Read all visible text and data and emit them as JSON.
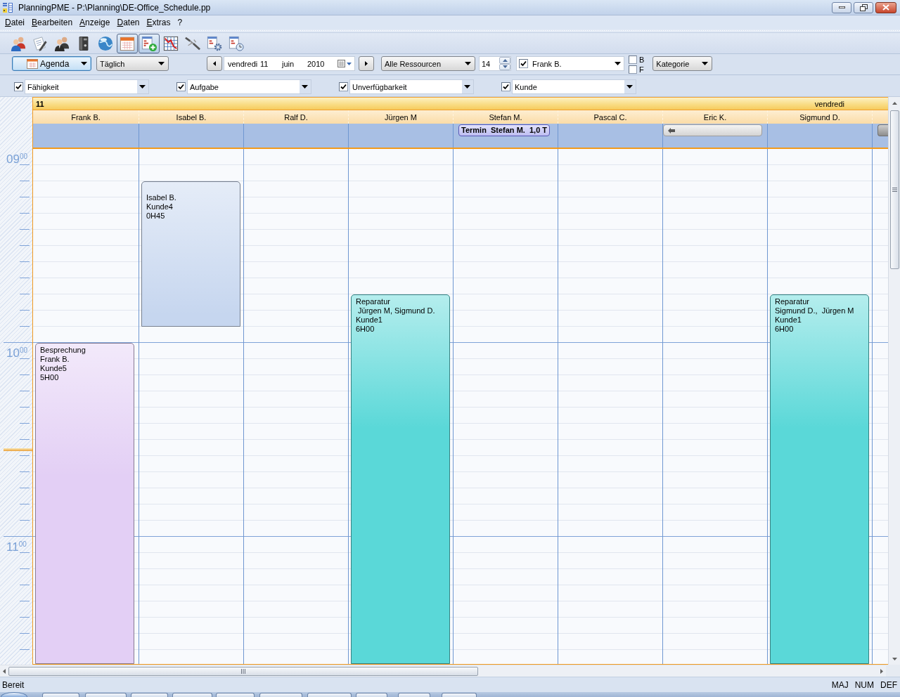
{
  "window": {
    "title": "PlanningPME - P:\\Planning\\DE-Office_Schedule.pp"
  },
  "menu": [
    "Datei",
    "Bearbeiten",
    "Anzeige",
    "Daten",
    "Extras",
    "?"
  ],
  "toolbar": [
    {
      "kind": "people",
      "pressed": false
    },
    {
      "kind": "notes",
      "pressed": false
    },
    {
      "kind": "team",
      "pressed": false
    },
    {
      "kind": "binder",
      "pressed": false
    },
    {
      "kind": "globe",
      "pressed": false
    },
    {
      "kind": "calendar",
      "pressed": true
    },
    {
      "kind": "add-task",
      "pressed": true
    },
    {
      "kind": "chart",
      "pressed": false
    },
    {
      "kind": "cable",
      "pressed": false
    },
    {
      "kind": "doc-gear",
      "pressed": false
    },
    {
      "kind": "doc-clock",
      "pressed": false
    }
  ],
  "view_bar": {
    "view": "Agenda",
    "period": "Täglich",
    "date": {
      "weekday": "vendredi",
      "day": "11",
      "month": "juin",
      "year": "2010"
    },
    "resource_filter": "Alle Ressourcen",
    "count": "14",
    "person": {
      "checked": true,
      "value": "Frank B."
    },
    "options": [
      {
        "label": "B",
        "checked": false
      },
      {
        "label": "F",
        "checked": false
      }
    ],
    "category": "Kategorie"
  },
  "filters": [
    {
      "label": "Fähigkeit",
      "checked": true
    },
    {
      "label": "Aufgabe",
      "checked": true
    },
    {
      "label": "Unverfügbarkeit",
      "checked": true
    },
    {
      "label": "Kunde",
      "checked": true
    }
  ],
  "schedule": {
    "day_number": "11",
    "day_name": "vendredi",
    "hours": [
      "09$^{00}$",
      "10$^{00}$",
      "11$^{00}$"
    ],
    "resources": [
      {
        "name": "Frank B.",
        "events": [
          {
            "title": "Besprechung",
            "lines": [
              "Frank B.",
              "Kunde5"
            ],
            "duration": "5H00",
            "color": "#e3cff5"
          }
        ]
      },
      {
        "name": "Isabel B.",
        "events": [
          {
            "lines": [
              "Isabel B.",
              "Kunde4"
            ],
            "duration": "0H45",
            "color": "#c6d6ef"
          }
        ]
      },
      {
        "name": "Ralf D."
      },
      {
        "name": "Jürgen M",
        "events": [
          {
            "title": "Reparatur",
            "lines": [
              " Jürgen M, Sigmund D.",
              "Kunde1"
            ],
            "duration": "6H00",
            "color": "#5ad8d8"
          }
        ]
      },
      {
        "name": "Stefan M.",
        "all_day": [
          {
            "kind": "pill",
            "text": "Termin  Stefan M.  1,0 T"
          }
        ]
      },
      {
        "name": "Pascal C."
      },
      {
        "name": "Eric K.",
        "all_day": [
          {
            "kind": "continued"
          }
        ]
      },
      {
        "name": "Sigmund D.",
        "events": [
          {
            "title": "Reparatur",
            "lines": [
              "Sigmund D.,  Jürgen M",
              "Kunde1"
            ],
            "duration": "6H00",
            "color": "#5ad8d8"
          }
        ]
      },
      {
        "all_day": [
          {
            "kind": "bar"
          }
        ]
      }
    ]
  },
  "status_bar": {
    "text": "Bereit",
    "indicators": [
      "MAJ",
      "NUM",
      "DEF"
    ]
  }
}
